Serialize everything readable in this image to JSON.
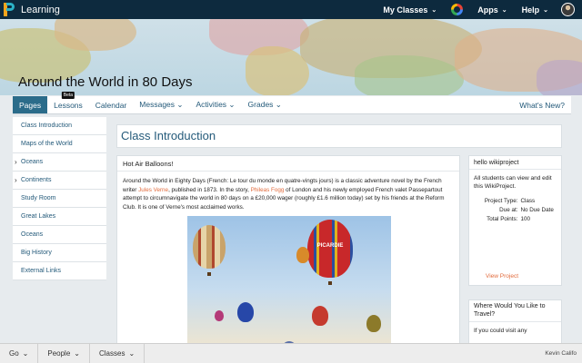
{
  "topbar": {
    "brand": "Learning",
    "nav": [
      {
        "label": "My Classes",
        "caret": "⌄"
      },
      {
        "label": "Apps",
        "caret": "⌄"
      },
      {
        "label": "Help",
        "caret": "⌄"
      }
    ],
    "icons": [
      "logo-icon",
      "google-icon",
      "avatar"
    ]
  },
  "banner": {
    "title": "Around the World in 80 Days"
  },
  "tabs": [
    {
      "label": "Pages",
      "active": true
    },
    {
      "label": "Lessons",
      "badge": "Beta"
    },
    {
      "label": "Calendar"
    },
    {
      "label": "Messages ⌄"
    },
    {
      "label": "Activities ⌄"
    },
    {
      "label": "Grades ⌄"
    },
    {
      "label": "What's New?"
    }
  ],
  "sidebar": {
    "items": [
      {
        "label": "Class Introduction",
        "chevron": ""
      },
      {
        "label": "Maps of the World",
        "chevron": ""
      },
      {
        "label": "Oceans",
        "chevron": "›"
      },
      {
        "label": "Continents",
        "chevron": "›"
      },
      {
        "label": "Study Room",
        "chevron": ""
      },
      {
        "label": "Great Lakes",
        "chevron": ""
      },
      {
        "label": "Oceans",
        "chevron": ""
      },
      {
        "label": "Big History",
        "chevron": ""
      },
      {
        "label": "External Links",
        "chevron": ""
      }
    ]
  },
  "main": {
    "title": "Class Introduction",
    "post": {
      "heading": "Hot Air Balloons!",
      "text_1": "Around the World in Eighty Days (French: Le tour du monde en quatre-vingts jours) is a classic adventure novel by the French writer ",
      "link_1": "Jules Verne",
      "text_2": ", published in 1873. In the story, ",
      "link_2": "Phileas Fogg",
      "text_3": " of London and his newly employed French valet Passepartout attempt to circumnavigate the world in 80 days on a £20,000 wager (roughly £1.6 million today) set by his friends at the Reform Club. It is one of Verne's most acclaimed works.",
      "image_caption": "PICARDIE"
    }
  },
  "wikiproject": {
    "heading": "hello wikiproject",
    "desc": "All students can view and edit this WikiProject.",
    "fields": [
      {
        "key": "Project Type:",
        "value": "Class"
      },
      {
        "key": "Due at:",
        "value": "No Due Date"
      },
      {
        "key": "Total Points:",
        "value": "100"
      }
    ],
    "view_link": "View Project"
  },
  "travel": {
    "heading": "Where Would You Like to Travel?",
    "desc": "If you could visit any"
  },
  "bottombar": {
    "items": [
      {
        "label": "Go",
        "caret": "⌄"
      },
      {
        "label": "People",
        "caret": "⌄"
      },
      {
        "label": "Classes",
        "caret": "⌄"
      }
    ],
    "user": "Kevin Califo"
  },
  "colors": {
    "topbar": "#0d2a3e",
    "accent": "#2b6c8a",
    "link": "#245a7a",
    "highlight_link": "#e26b3c"
  }
}
